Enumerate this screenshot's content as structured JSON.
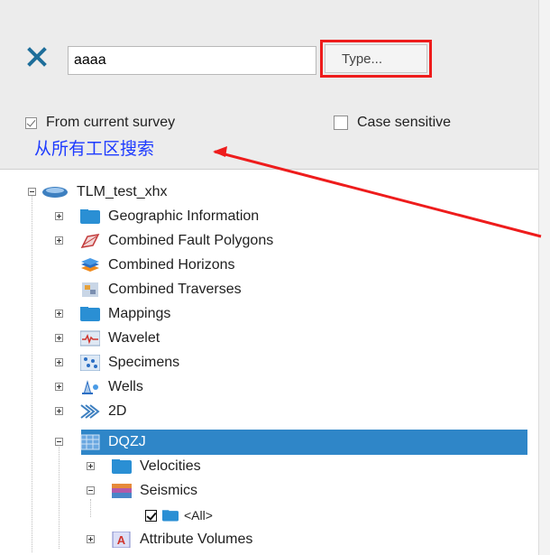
{
  "search": {
    "value": "aaaa",
    "type_button": "Type..."
  },
  "options": {
    "from_current_survey": "From current survey",
    "case_sensitive": "Case sensitive",
    "from_current_checked": true,
    "case_checked": false
  },
  "annotation": {
    "text": "从所有工区搜索",
    "color": "#1e3bff"
  },
  "colors": {
    "highlight": "#ee1c1c",
    "selection": "#2f86c8",
    "folder": "#2a8fd4"
  },
  "tree": {
    "root": "TLM_test_xhx",
    "items": [
      {
        "label": "Geographic Information",
        "icon": "folder-icon"
      },
      {
        "label": "Combined Fault Polygons",
        "icon": "fault-polygon-icon"
      },
      {
        "label": "Combined Horizons",
        "icon": "horizons-icon"
      },
      {
        "label": "Combined Traverses",
        "icon": "traverses-icon"
      },
      {
        "label": "Mappings",
        "icon": "folder-icon"
      },
      {
        "label": "Wavelet",
        "icon": "wavelet-icon"
      },
      {
        "label": "Specimens",
        "icon": "specimens-icon"
      },
      {
        "label": "Wells",
        "icon": "wells-icon"
      },
      {
        "label": "2D",
        "icon": "2d-icon"
      },
      {
        "label": "DQZJ",
        "icon": "survey-3d-icon"
      },
      {
        "label": "Velocities",
        "icon": "folder-icon"
      },
      {
        "label": "Seismics",
        "icon": "seismics-icon"
      },
      {
        "label": "<All>",
        "icon": "folder-icon"
      },
      {
        "label": "Attribute Volumes",
        "icon": "attribute-icon"
      }
    ]
  }
}
